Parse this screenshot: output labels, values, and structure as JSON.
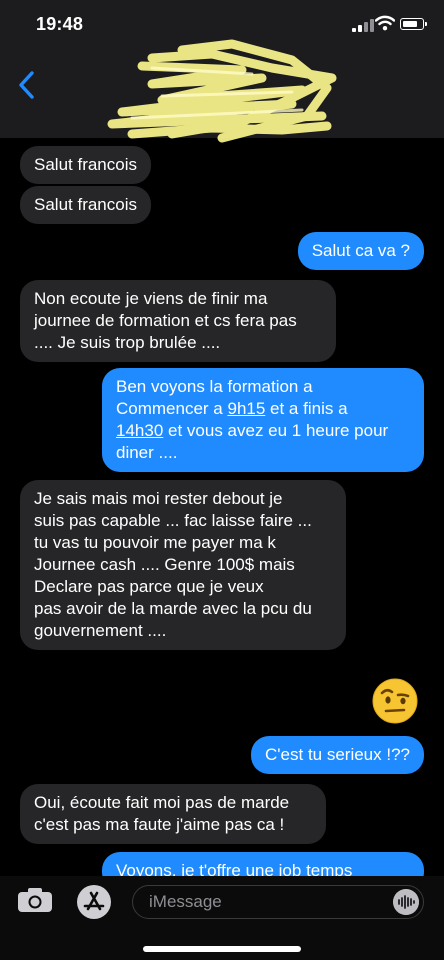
{
  "status_bar": {
    "time": "19:48",
    "battery_level": 0.8,
    "icons": [
      "signal-icon",
      "wifi-icon",
      "battery-icon"
    ]
  },
  "header": {
    "back_icon": "chevron-left-icon",
    "contact_name_redacted": true
  },
  "messages": [
    {
      "direction": "incoming",
      "text": "Salut francois"
    },
    {
      "direction": "incoming",
      "text": "Salut francois"
    },
    {
      "direction": "outgoing",
      "text": "Salut ca va ?"
    },
    {
      "direction": "incoming",
      "text": "Non ecoute je viens de finir ma\njournee de formation et cs fera pas\n.... Je suis trop brulée ...."
    },
    {
      "direction": "outgoing",
      "parts": {
        "p1": "Ben voyons la formation a\nCommencer a ",
        "link1": "9h15",
        "p2": " et a finis a\n",
        "link2": "14h30",
        "p3": " et vous avez eu 1 heure pour\ndiner ...."
      }
    },
    {
      "direction": "incoming",
      "text": "Je sais mais moi rester debout je\nsuis pas capable ... fac laisse faire ...\ntu vas tu pouvoir me payer ma k\nJournee cash .... Genre 100$ mais\nDeclare pas parce que je veux\npas avoir de la marde avec la pcu du\ngouvernement ...."
    },
    {
      "direction": "outgoing",
      "emoji": "raised-eyebrow-emoji"
    },
    {
      "direction": "outgoing",
      "text": "C'est tu serieux !??"
    },
    {
      "direction": "incoming",
      "text": "Oui, écoute fait moi pas de marde\nc'est pas ma faute j'aime pas ca !"
    },
    {
      "direction": "outgoing",
      "text": "Voyons, je t'offre une job temps"
    }
  ],
  "input_bar": {
    "placeholder": "iMessage",
    "icons": [
      "camera-icon",
      "app-store-icon",
      "audio-waveform-icon"
    ]
  },
  "colors": {
    "outgoing_bubble": "#1f8bff",
    "incoming_bubble": "#262628",
    "background": "#000000",
    "header": "#1c1c1e"
  }
}
